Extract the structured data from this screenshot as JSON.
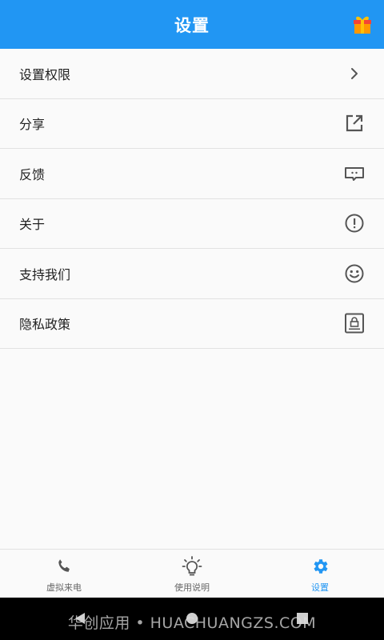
{
  "header": {
    "title": "设置"
  },
  "menu": [
    {
      "label": "设置权限",
      "icon": "chevron-right-icon"
    },
    {
      "label": "分享",
      "icon": "external-link-icon"
    },
    {
      "label": "反馈",
      "icon": "feedback-message-icon"
    },
    {
      "label": "关于",
      "icon": "exclamation-circle-icon"
    },
    {
      "label": "支持我们",
      "icon": "smiley-icon"
    },
    {
      "label": "隐私政策",
      "icon": "privacy-lock-document-icon"
    }
  ],
  "tabs": [
    {
      "label": "虚拟来电",
      "icon": "phone-icon",
      "active": false
    },
    {
      "label": "使用说明",
      "icon": "lightbulb-icon",
      "active": false
    },
    {
      "label": "设置",
      "icon": "gear-icon",
      "active": true
    }
  ],
  "watermark": "华创应用 • HUACHUANGZS.COM",
  "colors": {
    "primary": "#2196f3",
    "icon": "#555555",
    "text": "#222222",
    "background": "#fafafa"
  }
}
